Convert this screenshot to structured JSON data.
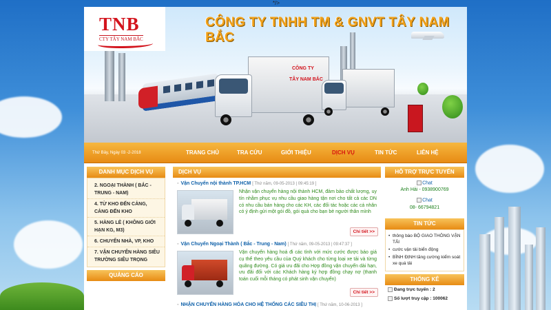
{
  "top_glyph": "*/>",
  "header": {
    "logo_text": "TNB",
    "logo_subtitle": "CTY TÂY NAM BẮC",
    "company_name": "CÔNG TY TNHH TM & GNVT TÂY NAM BẮC",
    "truck_label_1": "CÔNG TY",
    "truck_label_2": "TÂY NAM BẮC"
  },
  "nav": {
    "date": "Thứ Bảy, Ngày 03 -2-2018",
    "items": [
      "TRANG CHỦ",
      "TRA CỨU",
      "GIỚI THIỆU",
      "DỊCH VỤ",
      "TIN TỨC",
      "LIÊN HỆ"
    ]
  },
  "left": {
    "title": "DANH MỤC DỊCH VỤ",
    "items": [
      "2. NGOẠI THÀNH ( BẮC - TRUNG - NAM)",
      "4. TỪ KHO ĐẾN CẢNG, CẢNG ĐẾN KHO",
      "5. HÀNG LẺ ( KHÔNG GIỚI HẠN KG, M3)",
      "6. CHUYỂN NHÀ, VP, KHO",
      "7. VẬN CHUYỂN HÀNG SIÊU TRƯỜNG SIÊU TRỌNG"
    ],
    "ads_title": "QUẢNG CÁO"
  },
  "main": {
    "section_title": "DỊCH VỤ",
    "posts": [
      {
        "title": "Vận Chuyển nội thành TP.HCM",
        "date": "[ Thứ năm, 09-05-2013 | 09:45:19 ]",
        "text": "Nhận vận chuyển hàng nội thành HCM, đảm bảo chất lượng, uy tín nhằm phục vụ nhu cầu giao hàng tận nơi cho tất cả các DN có nhu cầu bán hàng cho các KH, các đối tác hoặc các cá nhân có ý định gửi một gói đồ, gói quà cho bạn bè người thân mình",
        "more": "Chi tiết >>"
      },
      {
        "title": "Vận Chuyển Ngoại Thành ( Bắc - Trung - Nam)",
        "date": "[ Thứ năm, 09-05-2013 | 09:47:37 ]",
        "text": "Vận chuyển hàng hoá đi các tỉnh với mức cước được báo giá cụ thể theo yêu cầu của Quý khách cho từng loại xe tải và từng quãng đường. Có giá ưu đãi cho Hợp đồng vận chuyển dài hạn, ưu đãi đối với các Khách hàng ký hợp đồng chạy nợ (thanh toán cuối mỗi tháng có phát sinh vận chuyển)",
        "more": "Chi tiết >>"
      },
      {
        "title": "NHẬN CHUYỂN HÀNG HÓA CHO HỆ THỐNG CÁC SIÊU THỊ",
        "date": "[ Thứ năm, 10-06-2013 ]"
      }
    ]
  },
  "right": {
    "support_title": "HỖ TRỢ TRỰC TUYẾN",
    "chat_label": "Chat",
    "support_1": "Anh Hải - 0938900769",
    "support_2": "08- 66794821",
    "news_title": "TIN TỨC",
    "news": [
      "thông báo BỘ GIAO THÔNG VẬN TẢI",
      "cước vận tải biển động",
      "BÌNH ĐỊNH tăng cường kiểm soát xe quá tải"
    ],
    "stats_title": "THỐNG KÊ",
    "online_label": "Đang trực tuyến :",
    "online_value": "2",
    "visits_label": "Số lượt truy cập :",
    "visits_value": "100062"
  }
}
